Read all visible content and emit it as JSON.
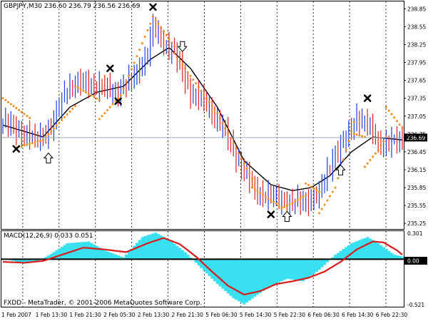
{
  "main_panel": {
    "title": "GBPJPY,M30  236.60 236.79 236.56 236.69",
    "current_price_label": "236.69",
    "y_ticks": [
      "238.85",
      "238.55",
      "238.25",
      "237.95",
      "237.65",
      "237.35",
      "237.05",
      "236.75",
      "236.45",
      "236.15",
      "235.85",
      "235.55",
      "235.25"
    ]
  },
  "macd_panel": {
    "title": "MACD(12,26,9) 0.033 0.051",
    "y_ticks": [
      "0.301",
      "0.00",
      "-0.521"
    ],
    "zero_label": "0.00"
  },
  "footer": {
    "copyright": "FXDD - MetaTrader, © 2001-2006 MetaQuotes Software Corp."
  },
  "x_labels": [
    "1 Feb 2007",
    "1 Feb 13:30",
    "1 Feb 21:30",
    "2 Feb 05:30",
    "2 Feb 13:30",
    "2 Feb 21:30",
    "5 Feb 06:30",
    "5 Feb 14:30",
    "5 Feb 22:30",
    "6 Feb 06:30",
    "6 Feb 14:30",
    "6 Feb 22:30"
  ],
  "colors": {
    "bull_bar": "#1f3fe0",
    "bear_bar": "#e01f1f",
    "sar_dots": "#f08a1a",
    "moving_average": "#000000",
    "macd_histogram": "#38e0f0",
    "macd_signal": "#d81c1c",
    "current_price_line": "#9aa8b8"
  },
  "chart_data": [
    {
      "type": "candlestick-bar",
      "title": "GBPJPY,M30",
      "ylim": [
        235.18,
        238.95
      ],
      "x_labels": [
        "1 Feb 2007",
        "1 Feb 13:30",
        "1 Feb 21:30",
        "2 Feb 05:30",
        "2 Feb 13:30",
        "2 Feb 21:30",
        "5 Feb 06:30",
        "5 Feb 14:30",
        "5 Feb 22:30",
        "6 Feb 06:30",
        "6 Feb 14:30",
        "6 Feb 22:30"
      ],
      "price_path": [
        [
          0,
          236.95
        ],
        [
          6,
          236.8
        ],
        [
          12,
          236.65
        ],
        [
          18,
          236.85
        ],
        [
          24,
          237.55
        ],
        [
          30,
          237.6
        ],
        [
          36,
          237.55
        ],
        [
          42,
          237.45
        ],
        [
          48,
          237.65
        ],
        [
          54,
          238.1
        ],
        [
          56,
          238.55
        ],
        [
          58,
          238.4
        ],
        [
          64,
          238.1
        ],
        [
          70,
          237.45
        ],
        [
          76,
          237.25
        ],
        [
          82,
          236.85
        ],
        [
          88,
          236.3
        ],
        [
          94,
          235.8
        ],
        [
          100,
          235.7
        ],
        [
          106,
          235.6
        ],
        [
          112,
          235.6
        ],
        [
          118,
          235.75
        ],
        [
          124,
          236.45
        ],
        [
          128,
          236.65
        ],
        [
          132,
          237.05
        ],
        [
          136,
          236.9
        ],
        [
          140,
          236.6
        ],
        [
          144,
          236.6
        ],
        [
          149,
          236.65
        ]
      ],
      "moving_average": [
        [
          0,
          236.9
        ],
        [
          15,
          236.7
        ],
        [
          25,
          237.2
        ],
        [
          35,
          237.45
        ],
        [
          45,
          237.55
        ],
        [
          55,
          238.0
        ],
        [
          62,
          238.2
        ],
        [
          70,
          237.85
        ],
        [
          80,
          237.2
        ],
        [
          90,
          236.3
        ],
        [
          100,
          235.9
        ],
        [
          108,
          235.8
        ],
        [
          115,
          235.85
        ],
        [
          122,
          236.05
        ],
        [
          130,
          236.45
        ],
        [
          138,
          236.7
        ],
        [
          149,
          236.65
        ]
      ],
      "sar_segments": [
        [
          [
            0,
            237.35
          ],
          [
            10,
            237.02
          ]
        ],
        [
          [
            5,
            236.52
          ],
          [
            15,
            236.65
          ],
          [
            27,
            237.22
          ]
        ],
        [
          [
            27,
            237.55
          ],
          [
            36,
            237.32
          ]
        ],
        [
          [
            36,
            237.0
          ],
          [
            44,
            237.4
          ],
          [
            55,
            238.6
          ]
        ],
        [
          [
            56,
            238.72
          ],
          [
            64,
            238.22
          ]
        ],
        [
          [
            64,
            238.1
          ],
          [
            80,
            237.1
          ],
          [
            93,
            236.0
          ]
        ],
        [
          [
            93,
            235.85
          ],
          [
            104,
            235.52
          ]
        ],
        [
          [
            104,
            235.5
          ],
          [
            113,
            235.72
          ]
        ],
        [
          [
            113,
            235.92
          ],
          [
            118,
            235.78
          ]
        ],
        [
          [
            118,
            235.42
          ],
          [
            124,
            235.85
          ],
          [
            131,
            236.95
          ]
        ],
        [
          [
            131,
            236.75
          ],
          [
            135,
            236.7
          ]
        ],
        [
          [
            135,
            236.2
          ],
          [
            140,
            236.48
          ],
          [
            143,
            236.7
          ]
        ],
        [
          [
            143,
            237.2
          ],
          [
            149,
            236.85
          ]
        ]
      ],
      "sell_markers": [
        [
          5,
          236.5
        ],
        [
          40,
          237.85
        ],
        [
          43,
          237.3
        ],
        [
          56,
          238.88
        ],
        [
          100,
          235.4
        ],
        [
          136,
          237.35
        ]
      ],
      "buy_arrows": [
        [
          17,
          236.43
        ],
        [
          106,
          235.45
        ],
        [
          126,
          236.23
        ]
      ],
      "sell_arrows": [
        [
          67,
          238.3
        ]
      ],
      "current_price": 236.69
    },
    {
      "type": "macd",
      "title": "MACD(12,26,9)",
      "ylim": [
        -0.521,
        0.301
      ],
      "histogram": [
        [
          0,
          0.01
        ],
        [
          8,
          -0.05
        ],
        [
          14,
          -0.01
        ],
        [
          18,
          0.06
        ],
        [
          24,
          0.18
        ],
        [
          32,
          0.2
        ],
        [
          38,
          0.1
        ],
        [
          45,
          0.02
        ],
        [
          52,
          0.25
        ],
        [
          57,
          0.3
        ],
        [
          62,
          0.22
        ],
        [
          68,
          0.08
        ],
        [
          74,
          -0.1
        ],
        [
          80,
          -0.28
        ],
        [
          86,
          -0.44
        ],
        [
          90,
          -0.51
        ],
        [
          95,
          -0.4
        ],
        [
          100,
          -0.3
        ],
        [
          106,
          -0.22
        ],
        [
          112,
          -0.25
        ],
        [
          118,
          -0.12
        ],
        [
          124,
          0.05
        ],
        [
          130,
          0.18
        ],
        [
          136,
          0.25
        ],
        [
          140,
          0.18
        ],
        [
          146,
          0.05
        ],
        [
          149,
          0.03
        ]
      ],
      "signal": [
        [
          0,
          -0.03
        ],
        [
          8,
          -0.04
        ],
        [
          15,
          -0.02
        ],
        [
          22,
          0.05
        ],
        [
          30,
          0.13
        ],
        [
          38,
          0.11
        ],
        [
          46,
          0.08
        ],
        [
          54,
          0.18
        ],
        [
          60,
          0.24
        ],
        [
          66,
          0.17
        ],
        [
          72,
          0.03
        ],
        [
          78,
          -0.14
        ],
        [
          84,
          -0.3
        ],
        [
          90,
          -0.4
        ],
        [
          96,
          -0.36
        ],
        [
          102,
          -0.28
        ],
        [
          108,
          -0.25
        ],
        [
          114,
          -0.21
        ],
        [
          120,
          -0.14
        ],
        [
          126,
          -0.03
        ],
        [
          132,
          0.11
        ],
        [
          138,
          0.2
        ],
        [
          142,
          0.19
        ],
        [
          147,
          0.1
        ],
        [
          149,
          0.05
        ]
      ],
      "value_macd": 0.033,
      "value_signal": 0.051
    }
  ]
}
